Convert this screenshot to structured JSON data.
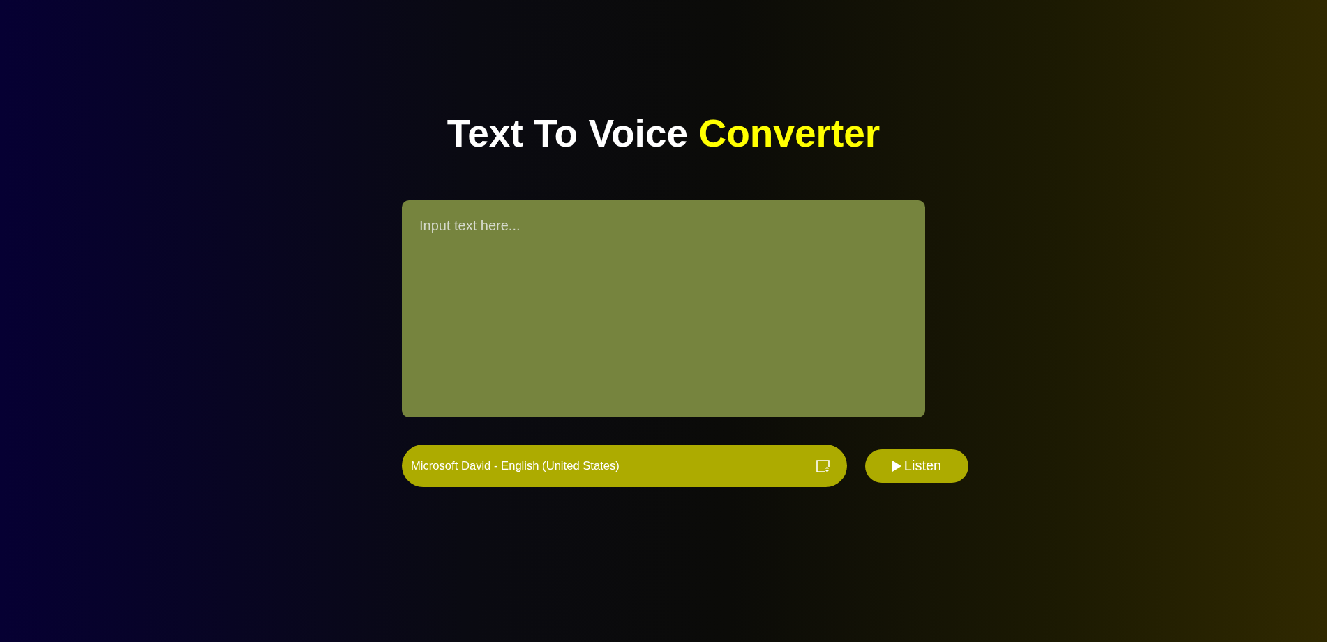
{
  "title": [
    {
      "text": "Text To Voice",
      "kind": "plain"
    },
    {
      "text": "Converter",
      "kind": "accent"
    }
  ],
  "text_input": {
    "placeholder": "Input text here..."
  },
  "voice_select": {
    "value": "Microsoft David - English (United States)"
  },
  "buttons": [
    {
      "label": "Listen",
      "kind": "play"
    }
  ]
}
